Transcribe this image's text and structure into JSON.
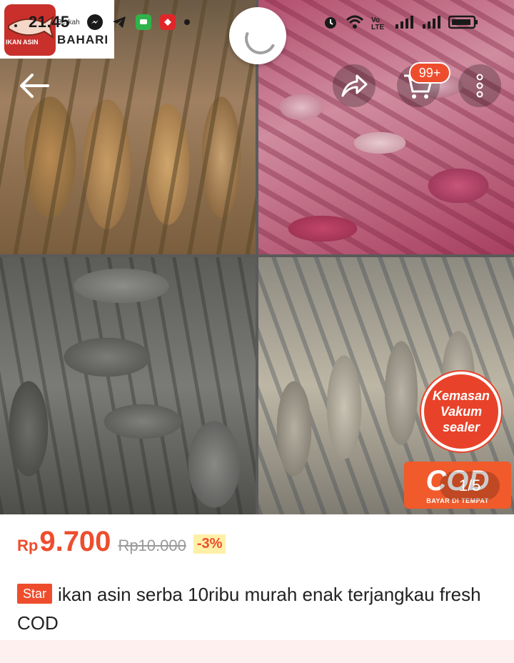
{
  "status_bar": {
    "time": "21.45",
    "icons_left": [
      "messenger-icon",
      "telegram-icon",
      "chat-icon",
      "app-icon",
      "dot-icon"
    ],
    "icons_right": [
      "alarm-icon",
      "wifi-icon",
      "volte-icon",
      "signal-icon",
      "signal-icon",
      "battery-icon"
    ],
    "volte_label": "Vo LTE"
  },
  "shop_logo": {
    "tag": "IKAN ASIN",
    "berkah": "Berkah",
    "bahari": "BAHARI"
  },
  "nav": {
    "cart_badge": "99+"
  },
  "gallery": {
    "pager": "1/5",
    "sticker_vakum": [
      "Kemasan",
      "Vakum",
      "sealer"
    ],
    "sticker_cod": "COD",
    "sticker_cod_sub": "BAYAR DI TEMPAT",
    "colors": {
      "fish_brown": "#a07a4b",
      "squid_pink": "#c25577",
      "fish_grey": "#6e6f6b",
      "fish_silver": "#b5afa2"
    }
  },
  "product": {
    "currency": "Rp",
    "price": "9.700",
    "old_price": "Rp10.000",
    "discount": "-3%",
    "badge": "Star",
    "title": "ikan asin serba 10ribu murah enak terjangkau fresh COD"
  },
  "theme": {
    "accent": "#ee4d2d",
    "discount_bg": "#fff0a8"
  }
}
